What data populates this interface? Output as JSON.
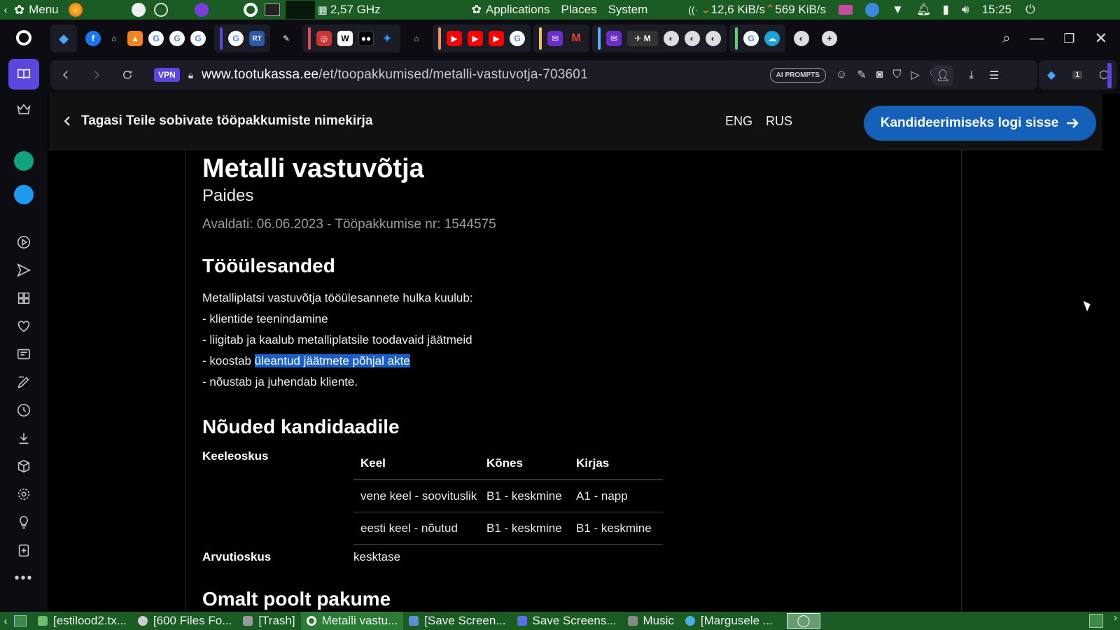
{
  "system_panel": {
    "menu_label": "Menu",
    "cpu_freq": "2,57 GHz",
    "applications": "Applications",
    "places": "Places",
    "system": "System",
    "net_down": "12,6 KiB/s",
    "net_up": "569 KiB/s",
    "clock": "15:25"
  },
  "browser": {
    "vpn_label": "VPN",
    "url_domain": "www.tootukassa.ee",
    "url_path": "/et/toopakkumised/metalli-vastuvotja-703601",
    "ai_prompts_label": "AI PROMPTS",
    "tab_badge": "1"
  },
  "page_header": {
    "back_label": "Tagasi Teile sobivate tööpakkumiste nimekirja",
    "lang_eng": "ENG",
    "lang_rus": "RUS",
    "login_label": "Kandideerimiseks logi sisse"
  },
  "job": {
    "title": "Metalli vastuvõtja",
    "location": "Paides",
    "meta": "Avaldati: 06.06.2023 - Tööpakkumise nr: 1544575",
    "tasks_heading": "Tööülesanded",
    "tasks_intro": "Metalliplatsi vastuvõtja tööülesannete hulka kuulub:",
    "task_1": "- klientide teenindamine",
    "task_2": "- liigitab ja kaalub metalliplatsile toodavaid jäätmeid",
    "task_3_prefix": "- koostab ",
    "task_3_highlight": "üleantud jäätmete põhjal akte",
    "task_4": "- nõustab ja juhendab kliente.",
    "requirements_heading": "Nõuded kandidaadile",
    "language_label": "Keeleoskus",
    "computer_label": "Arvutioskus",
    "computer_value": "kesktase",
    "next_heading": "Omalt poolt pakume",
    "language_table": {
      "headers": [
        "Keel",
        "Kõnes",
        "Kirjas"
      ],
      "rows": [
        [
          "vene keel - soovituslik",
          "B1 - keskmine",
          "A1 - napp"
        ],
        [
          "eesti keel - nõutud",
          "B1 - keskmine",
          "B1 - keskmine"
        ]
      ]
    }
  },
  "taskbar": {
    "items": [
      "[estilood2.tx...",
      "[600 Files Fo...",
      "[Trash]",
      "Metalli vastu...",
      "[Save Screen...",
      "Save Screens...",
      "Music",
      "[Margusele ..."
    ]
  },
  "colors": {
    "panel_green": "#1a5c23",
    "accent_blue": "#1560b8",
    "highlight": "#1a5fc7"
  }
}
